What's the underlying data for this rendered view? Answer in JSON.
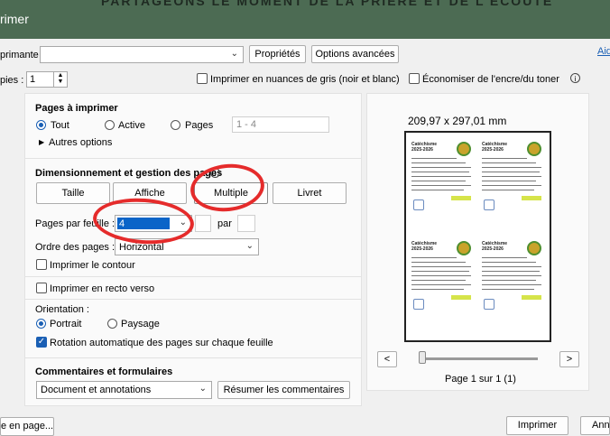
{
  "window": {
    "title": "rimer",
    "bleed_text": "PARTAGEONS LE MOMENT DE LA PRIÈRE ET DE L'ÉCOUTE"
  },
  "printer": {
    "label": "primante :",
    "value": "",
    "properties_button": "Propriétés",
    "advanced_button": "Options avancées",
    "help_link": "Aid"
  },
  "copies": {
    "label": "pies :",
    "value": "1",
    "grayscale_label": "Imprimer en nuances de gris (noir et blanc)",
    "save_ink_label": "Économiser de l'encre/du toner",
    "info_icon": "info-icon"
  },
  "pages_section": {
    "title": "Pages à imprimer",
    "all_label": "Tout",
    "current_label": "Active",
    "pages_label": "Pages",
    "pages_placeholder": "1 - 4",
    "more_options": "Autres options"
  },
  "sizing_section": {
    "title": "Dimensionnement et gestion des pages",
    "info_icon": "info-icon",
    "buttons": [
      "Taille",
      "Affiche",
      "Multiple",
      "Livret"
    ],
    "pages_per_sheet_label": "Pages par feuille :",
    "pages_per_sheet_value": "4",
    "by_label": "par",
    "page_order_label": "Ordre des pages :",
    "page_order_value": "Horizontal",
    "print_border_label": "Imprimer le contour"
  },
  "duplex": {
    "label": "Imprimer en recto verso"
  },
  "orientation": {
    "label": "Orientation :",
    "portrait_label": "Portrait",
    "landscape_label": "Paysage",
    "auto_rotate_label": "Rotation automatique des pages sur chaque feuille"
  },
  "comments_section": {
    "title": "Commentaires et formulaires",
    "dropdown_value": "Document et annotations",
    "summarize_button": "Résumer les commentaires"
  },
  "preview": {
    "size_label": "209,97 x 297,01 mm",
    "prev_button": "<",
    "next_button": ">",
    "page_label": "Page 1 sur 1 (1)",
    "thumb_title_1": "Catéchisme",
    "thumb_title_2": "2025-2026"
  },
  "footer": {
    "page_setup_button": "e en page...",
    "print_button": "Imprimer",
    "cancel_button": "Ann"
  },
  "colors": {
    "titlebar": "#4c6b53",
    "accent": "#1a5fb4",
    "annotation": "#e52b2b"
  }
}
